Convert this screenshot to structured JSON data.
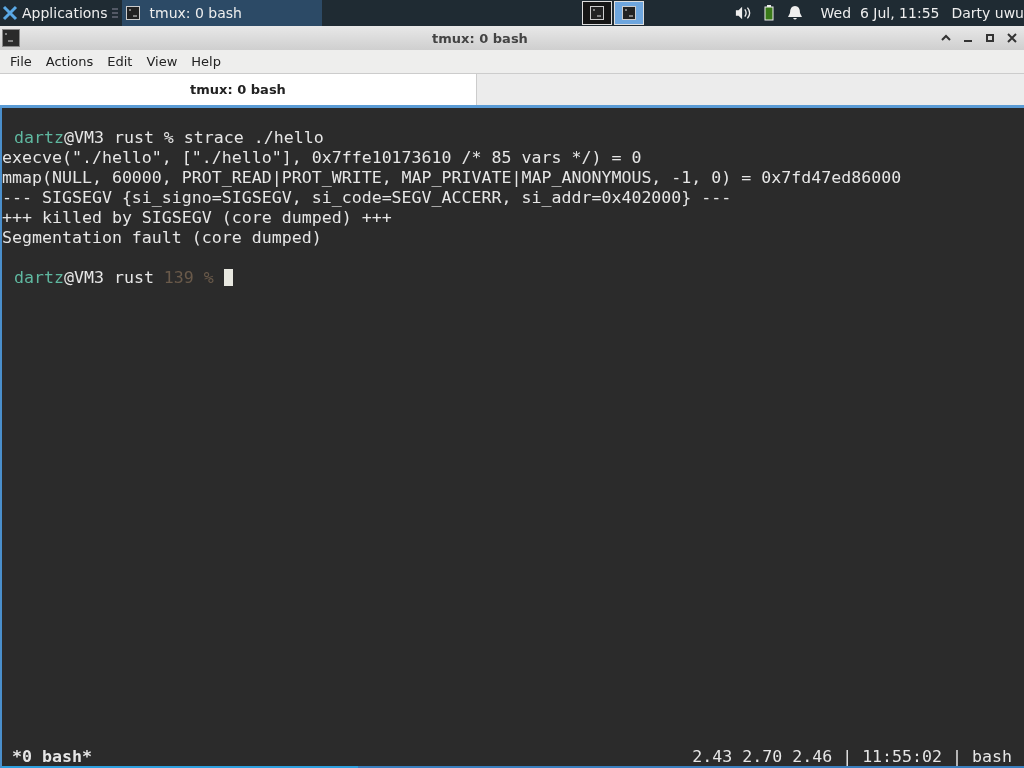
{
  "panel": {
    "apps_menu": "Applications",
    "tasks": [
      {
        "label": "tmux: 0 bash",
        "selected": true
      }
    ],
    "workspaces": [
      {
        "selected": false
      },
      {
        "selected": true
      }
    ],
    "clock": "Wed  6 Jul, 11:55",
    "user": "Darty uwu"
  },
  "window": {
    "title": "tmux: 0 bash",
    "menu": [
      "File",
      "Actions",
      "Edit",
      "View",
      "Help"
    ],
    "tabs": [
      {
        "label": "tmux: 0 bash",
        "selected": true
      }
    ]
  },
  "terminal": {
    "lines": [
      {
        "segments": [
          {
            "text": "dartz",
            "kind": "user"
          },
          {
            "text": "@VM3 rust % strace ./hello",
            "kind": "plain"
          }
        ]
      },
      {
        "segments": [
          {
            "text": "execve(\"./hello\", [\"./hello\"], 0x7ffe10173610 /* 85 vars */) = 0",
            "kind": "plain"
          }
        ]
      },
      {
        "segments": [
          {
            "text": "mmap(NULL, 60000, PROT_READ|PROT_WRITE, MAP_PRIVATE|MAP_ANONYMOUS, -1, 0) = 0x7fd47ed86000",
            "kind": "plain"
          }
        ]
      },
      {
        "segments": [
          {
            "text": "--- SIGSEGV {si_signo=SIGSEGV, si_code=SEGV_ACCERR, si_addr=0x402000} ---",
            "kind": "plain"
          }
        ]
      },
      {
        "segments": [
          {
            "text": "+++ killed by SIGSEGV (core dumped) +++",
            "kind": "plain"
          }
        ]
      },
      {
        "segments": [
          {
            "text": "Segmentation fault (core dumped)",
            "kind": "plain"
          }
        ]
      }
    ],
    "prompt": {
      "cursor": true,
      "segments": [
        {
          "text": "dartz",
          "kind": "user"
        },
        {
          "text": "@VM3 rust ",
          "kind": "plain"
        },
        {
          "text": "139 %",
          "kind": "dim"
        }
      ]
    },
    "status_left": "*0 bash*",
    "status_right": "2.43 2.70 2.46 | 11:55:02 | bash"
  }
}
